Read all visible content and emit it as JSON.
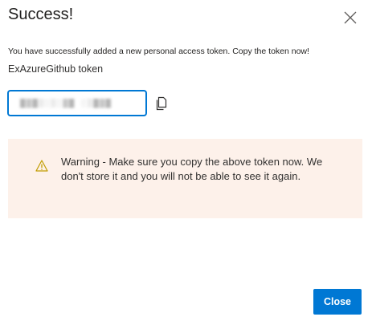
{
  "dialog": {
    "title": "Success!",
    "message": "You have successfully added a new personal access token. Copy the token now!",
    "token_name": "ExAzureGithub token",
    "token_value": "█▓█▒░▒░▓█ ░▒█▓█",
    "warning": {
      "icon": "warning-icon",
      "text": "Warning - Make sure you copy the above token now. We don't store it and you will not be able to see it again."
    },
    "close_button_label": "Close"
  },
  "colors": {
    "accent": "#0078d4",
    "warning_bg": "#fdf1ea",
    "warning_icon": "#c19c00"
  },
  "icons": {
    "close": "close-icon",
    "copy": "copy-icon"
  }
}
